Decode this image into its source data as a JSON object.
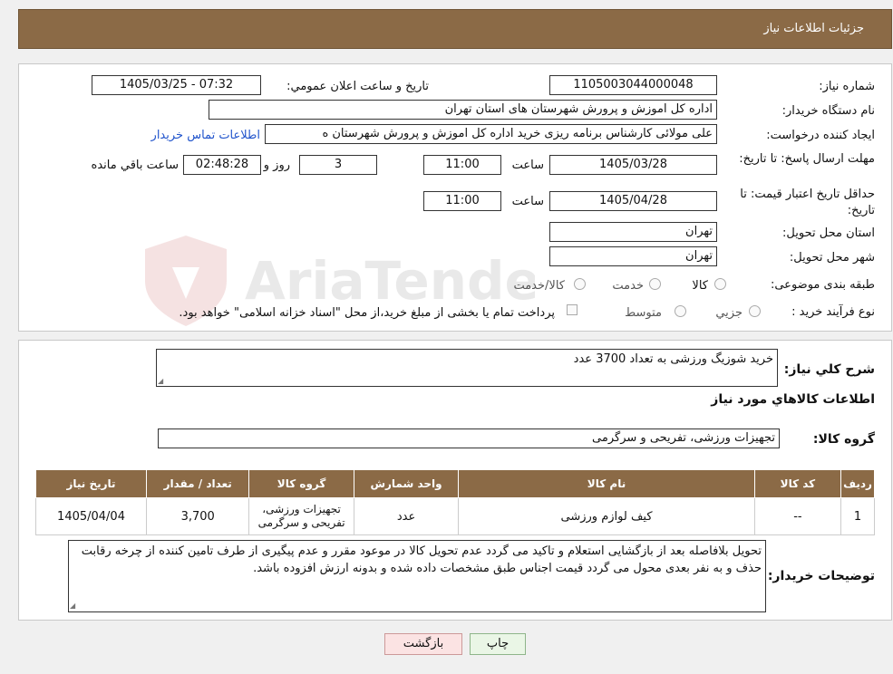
{
  "header": {
    "title": "جزئیات اطلاعات نیاز"
  },
  "form": {
    "need_number_label": "شماره نیاز:",
    "need_number": "1105003044000048",
    "announce_label": "تاریخ و ساعت اعلان عمومي:",
    "announce_value": "1405/03/25 - 07:32",
    "buyer_label": "نام دستگاه خريدار:",
    "buyer_value": "اداره کل اموزش و پرورش شهرستان های استان تهران",
    "creator_label": "ایجاد کننده درخواست:",
    "creator_value": "علی مولائی کارشناس برنامه ریزی خرید  اداره کل اموزش و پرورش شهرستان ه",
    "contact_link": "اطلاعات تماس خريدار",
    "deadline_label": "مهلت ارسال پاسخ: تا تاریخ:",
    "deadline_date": "1405/03/28",
    "time_label": "ساعت",
    "deadline_time": "11:00",
    "days_value": "3",
    "days_label": "روز و",
    "remaining_value": "02:48:28",
    "remaining_label": "ساعت باقي مانده",
    "validity_label": "حداقل تاریخ اعتبار قیمت: تا تاریخ:",
    "validity_date": "1405/04/28",
    "validity_time": "11:00",
    "province_label": "استان محل تحویل:",
    "province_value": "تهران",
    "city_label": "شهر محل تحویل:",
    "city_value": "تهران",
    "category_label": "طبقه بندی موضوعی:",
    "category_options": [
      "کالا",
      "خدمت",
      "کالا/خدمت"
    ],
    "process_label": "نوع فرآیند خرید :",
    "process_options": [
      "جزیي",
      "متوسط"
    ],
    "payment_note": "پرداخت تمام یا بخشی از مبلغ خرید،از محل \"اسناد خزانه اسلامی\" خواهد بود."
  },
  "details": {
    "desc_label": "شرح کلي نياز:",
    "desc_value": "خرید شوزیگ ورزشی به تعداد 3700 عدد",
    "goods_heading": "اطلاعات کالاهاي مورد نياز",
    "group_label": "گروه کالا:",
    "group_value": "تجهیزات ورزشی، تفریحی و سرگرمی",
    "table": {
      "headers": [
        "رديف",
        "کد کالا",
        "نام کالا",
        "واحد شمارش",
        "گروه کالا",
        "تعداد / مقدار",
        "تاريخ نياز"
      ],
      "rows": [
        [
          "1",
          "--",
          "کیف لوازم ورزشی",
          "عدد",
          "تجهیزات ورزشی، تفریحی و سرگرمی",
          "3,700",
          "1405/04/04"
        ]
      ]
    },
    "notes_label": "توضیحات خريدار:",
    "notes_value": "تحویل بلافاصله بعد از بازگشایی استعلام و تاکید می گردد عدم تحویل کالا در موعود مقرر و عدم پیگیری از طرف تامین کننده از چرخه رقابت حذف و به نفر بعدی محول می گردد قیمت اجناس طبق مشخصات داده شده و بدونه ارزش افزوده باشد."
  },
  "buttons": {
    "print": "چاپ",
    "back": "بازگشت"
  },
  "watermark": {
    "text": "AriaTender.neT"
  }
}
